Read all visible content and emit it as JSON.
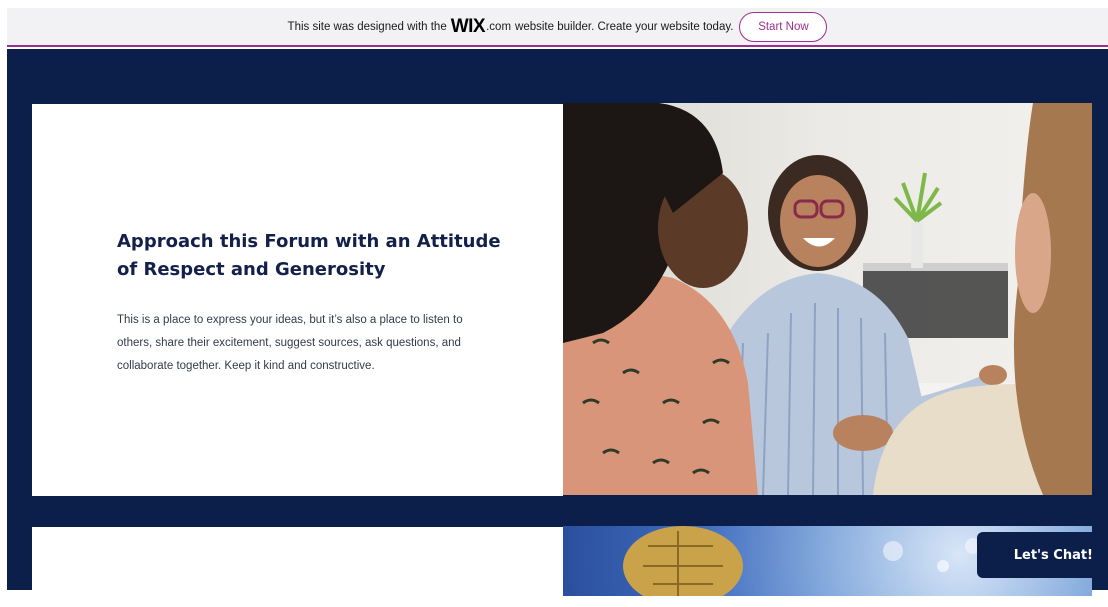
{
  "banner": {
    "text_before": "This site was designed with the",
    "logo_text": "WIX",
    "logo_suffix": ".com",
    "text_after": "website builder. Create your website today.",
    "button_label": "Start Now",
    "accent_color": "#9b2f8d"
  },
  "section1": {
    "heading": "Approach this Forum with an Attitude of Respect and Generosity",
    "body": "This is a place to express your ideas, but it’s also a place to listen to others, share their excitement, suggest sources, ask questions, and collaborate together. Keep it kind and constructive.",
    "image_icon": "women-discussion-photo"
  },
  "section2": {
    "image_icon": "card-chip-photo"
  },
  "chat": {
    "label": "Let's Chat!"
  },
  "colors": {
    "navy_background": "#0b1f4a",
    "heading_color": "#13204a"
  }
}
